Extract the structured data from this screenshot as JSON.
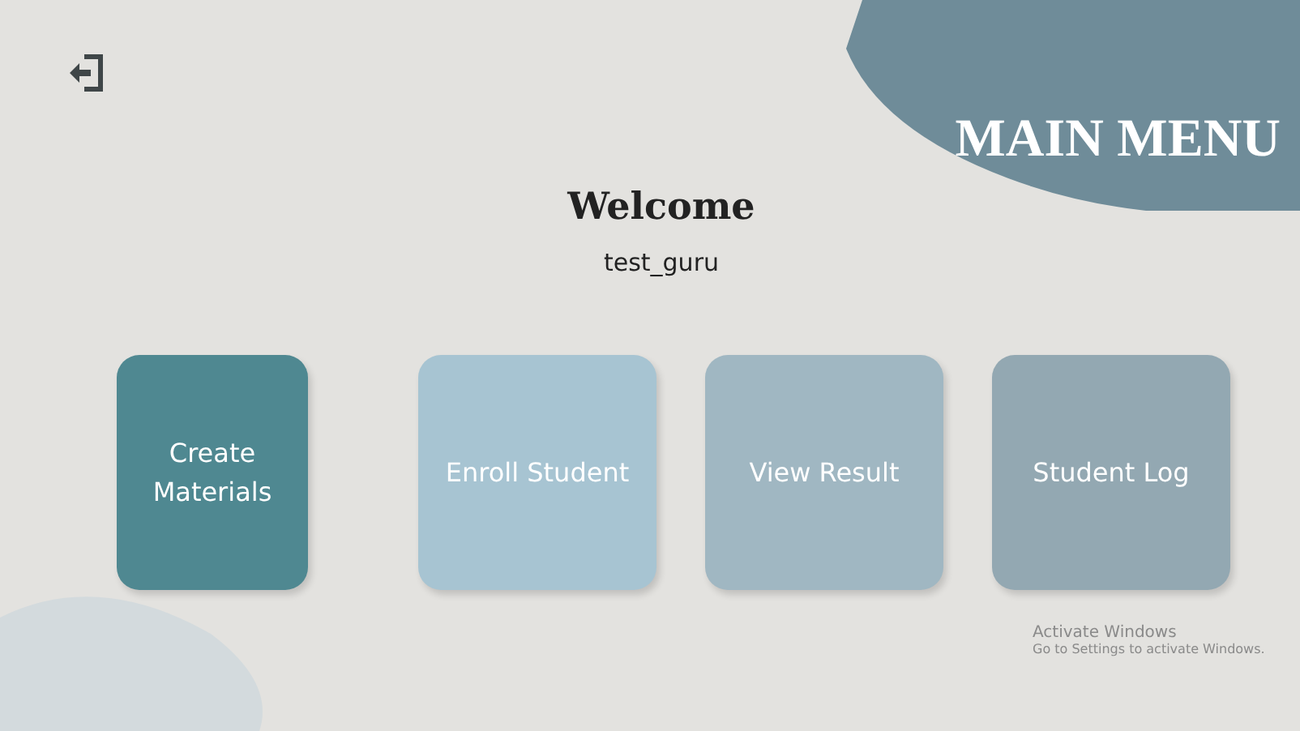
{
  "title": "MAIN MENU",
  "welcome": {
    "heading": "Welcome",
    "username": "test_guru"
  },
  "menu": [
    {
      "label": "Create Materials",
      "color": "#4f8891"
    },
    {
      "label": "Enroll Student",
      "color": "#a7c4d2"
    },
    {
      "label": "View Result",
      "color": "#a0b7c2"
    },
    {
      "label": "Student Log",
      "color": "#93a8b2"
    }
  ],
  "os_notice": {
    "title": "Activate Windows",
    "message": "Go to Settings to activate Windows."
  }
}
